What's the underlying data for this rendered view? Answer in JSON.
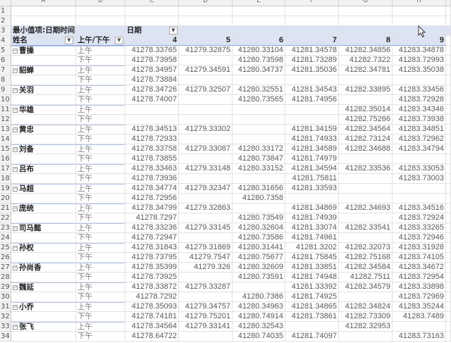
{
  "columns": [
    "A",
    "B",
    "C",
    "D",
    "E",
    "F",
    "G",
    "H"
  ],
  "pivot": {
    "value_label": "最小值项:日期时间",
    "col_field": "日期",
    "row_field_1": "姓名",
    "row_field_2": "上午/下午",
    "col_values": [
      "4",
      "5",
      "6",
      "7",
      "8",
      "9"
    ]
  },
  "rows": [
    {
      "name": "曹操",
      "ap": "上午",
      "v": [
        "41278.33765",
        "41279.32875",
        "41280.33104",
        "41281.34578",
        "41282.34856",
        "41283.34878"
      ]
    },
    {
      "name": "",
      "ap": "下午",
      "v": [
        "41278.73958",
        "",
        "41280.73598",
        "41281.73289",
        "41282.7322",
        "41283.72993"
      ]
    },
    {
      "name": "貂蝉",
      "ap": "上午",
      "v": [
        "41278.34957",
        "41279.34591",
        "41280.34737",
        "41281.35036",
        "41282.34781",
        "41283.35038"
      ]
    },
    {
      "name": "",
      "ap": "下午",
      "v": [
        "41278.73884",
        "",
        "",
        "",
        "",
        ""
      ]
    },
    {
      "name": "关羽",
      "ap": "上午",
      "v": [
        "41278.34726",
        "41279.32507",
        "41280.32551",
        "41281.34543",
        "41282.33895",
        "41283.33456"
      ]
    },
    {
      "name": "",
      "ap": "下午",
      "v": [
        "41278.74007",
        "",
        "41280.73565",
        "41281.74956",
        "",
        "41283.72928"
      ]
    },
    {
      "name": "华雄",
      "ap": "上午",
      "v": [
        "",
        "",
        "",
        "",
        "41282.35014",
        "41283.34346"
      ]
    },
    {
      "name": "",
      "ap": "下午",
      "v": [
        "",
        "",
        "",
        "",
        "41282.75266",
        "41283.73938"
      ]
    },
    {
      "name": "黄忠",
      "ap": "上午",
      "v": [
        "41278.34513",
        "41279.33302",
        "",
        "41281.34159",
        "41282.34564",
        "41283.34851"
      ]
    },
    {
      "name": "",
      "ap": "下午",
      "v": [
        "41278.72933",
        "",
        "",
        "41281.74933",
        "41282.73124",
        "41283.72962"
      ]
    },
    {
      "name": "刘备",
      "ap": "上午",
      "v": [
        "41278.33758",
        "41279.33087",
        "41280.33172",
        "41281.34589",
        "41282.34688",
        "41283.34794"
      ]
    },
    {
      "name": "",
      "ap": "下午",
      "v": [
        "41278.73855",
        "",
        "41280.73847",
        "41281.74979",
        "",
        ""
      ]
    },
    {
      "name": "吕布",
      "ap": "上午",
      "v": [
        "41278.33463",
        "41279.33148",
        "41280.33152",
        "41281.34594",
        "41282.33536",
        "41283.33053"
      ]
    },
    {
      "name": "",
      "ap": "下午",
      "v": [
        "41278.73936",
        "",
        "",
        "41281.75811",
        "",
        "41283.73003"
      ]
    },
    {
      "name": "马超",
      "ap": "上午",
      "v": [
        "41278.34774",
        "41279.32347",
        "41280.31656",
        "41281.33593",
        "",
        ""
      ]
    },
    {
      "name": "",
      "ap": "下午",
      "v": [
        "41278.72956",
        "",
        "41280.7358",
        "",
        "",
        ""
      ]
    },
    {
      "name": "庞统",
      "ap": "上午",
      "v": [
        "41278.34799",
        "41279.32863",
        "",
        "41281.34869",
        "41282.34693",
        "41283.34516"
      ]
    },
    {
      "name": "",
      "ap": "下午",
      "v": [
        "41278.7297",
        "",
        "41280.73549",
        "41281.74939",
        "",
        "41283.72924"
      ]
    },
    {
      "name": "司马懿",
      "ap": "上午",
      "v": [
        "41278.33236",
        "41279.33145",
        "41280.32604",
        "41281.33074",
        "41282.33541",
        "41283.33265"
      ]
    },
    {
      "name": "",
      "ap": "下午",
      "v": [
        "41278.72947",
        "",
        "41280.73586",
        "41281.74961",
        "",
        "41283.72946"
      ]
    },
    {
      "name": "孙权",
      "ap": "上午",
      "v": [
        "41278.31843",
        "41279.31869",
        "41280.31441",
        "41281.3202",
        "41282.32073",
        "41283.31928"
      ]
    },
    {
      "name": "",
      "ap": "下午",
      "v": [
        "41278.73795",
        "41279.7547",
        "41280.75677",
        "41281.75845",
        "41282.75168",
        "41283.74105"
      ]
    },
    {
      "name": "孙尚香",
      "ap": "上午",
      "v": [
        "41278.35399",
        "41279.326",
        "41280.32609",
        "41281.33851",
        "41282.34584",
        "41283.34672"
      ]
    },
    {
      "name": "",
      "ap": "下午",
      "v": [
        "41278.73925",
        "",
        "41280.73591",
        "41281.74948",
        "41282.7511",
        "41283.72954"
      ]
    },
    {
      "name": "魏延",
      "ap": "上午",
      "v": [
        "41278.33872",
        "41279.33287",
        "",
        "41281.33392",
        "41282.34579",
        "41283.33898"
      ]
    },
    {
      "name": "",
      "ap": "下午",
      "v": [
        "41278.7292",
        "",
        "41280.7386",
        "41281.74925",
        "",
        "41283.72969"
      ]
    },
    {
      "name": "小乔",
      "ap": "上午",
      "v": [
        "41278.35093",
        "41279.34757",
        "41280.34963",
        "41281.34865",
        "41282.34824",
        "41283.35244"
      ]
    },
    {
      "name": "",
      "ap": "下午",
      "v": [
        "41278.74181",
        "41279.75201",
        "41280.74914",
        "41281.73861",
        "41282.73309",
        "41283.7489"
      ]
    },
    {
      "name": "张飞",
      "ap": "上午",
      "v": [
        "41278.34564",
        "41279.33141",
        "41280.32543",
        "",
        "41282.32953",
        ""
      ]
    },
    {
      "name": "",
      "ap": "下午",
      "v": [
        "41278.64722",
        "",
        "41280.74035",
        "41281.74097",
        "",
        "41283.73163"
      ]
    }
  ]
}
